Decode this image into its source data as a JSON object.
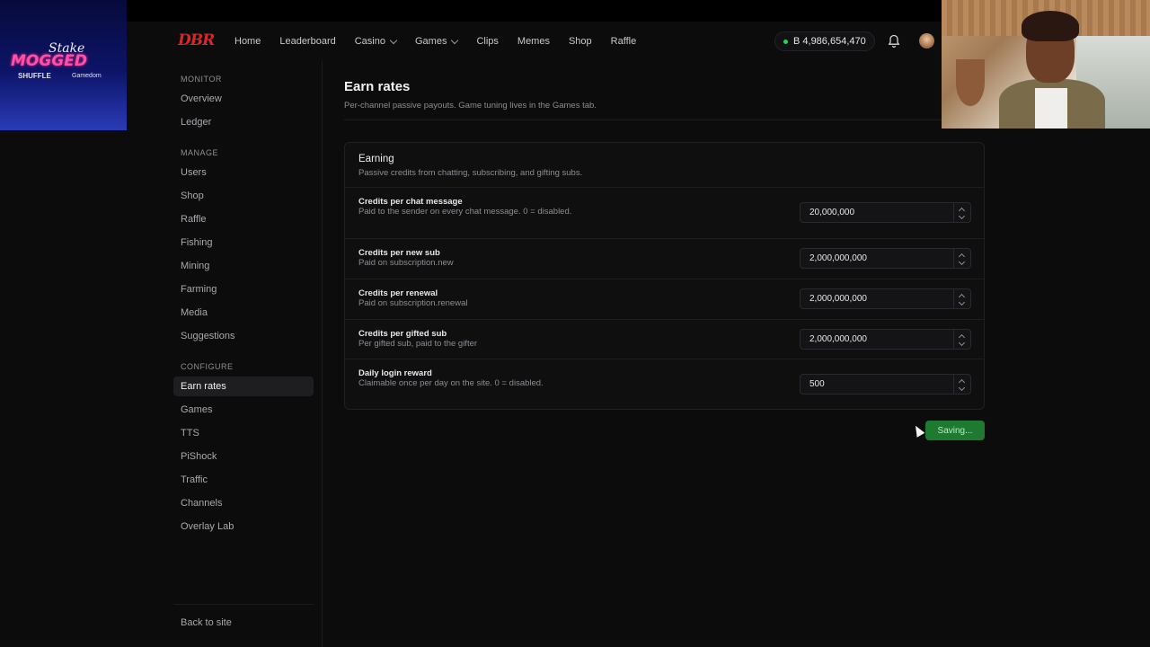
{
  "header": {
    "logo": "DBR",
    "nav": [
      {
        "label": "Home",
        "dropdown": false
      },
      {
        "label": "Leaderboard",
        "dropdown": false
      },
      {
        "label": "Casino",
        "dropdown": true
      },
      {
        "label": "Games",
        "dropdown": true
      },
      {
        "label": "Clips",
        "dropdown": false
      },
      {
        "label": "Memes",
        "dropdown": false
      },
      {
        "label": "Shop",
        "dropdown": false
      },
      {
        "label": "Raffle",
        "dropdown": false
      }
    ],
    "balance": "B 4,986,654,470",
    "balance_status_color": "#2fcf5f"
  },
  "overlay": {
    "sponsor_line1": "Stake",
    "sponsor_line2": "MOGGED",
    "sponsor_line3": "SHUFFLE",
    "sponsor_line4": "Gamedom"
  },
  "sidebar": {
    "sections": [
      {
        "title": "MONITOR",
        "items": [
          "Overview",
          "Ledger"
        ]
      },
      {
        "title": "MANAGE",
        "items": [
          "Users",
          "Shop",
          "Raffle",
          "Fishing",
          "Mining",
          "Farming",
          "Media",
          "Suggestions"
        ]
      },
      {
        "title": "CONFIGURE",
        "items": [
          "Earn rates",
          "Games",
          "TTS",
          "PiShock",
          "Traffic",
          "Channels",
          "Overlay Lab"
        ]
      }
    ],
    "active_item": "Earn rates",
    "footer": "Back to site"
  },
  "main": {
    "title": "Earn rates",
    "subtitle": "Per-channel passive payouts. Game tuning lives in the Games tab.",
    "card": {
      "title": "Earning",
      "subtitle": "Passive credits from chatting, subscribing, and gifting subs.",
      "rows": [
        {
          "label": "Credits per chat message",
          "desc": "Paid to the sender on every chat message. 0 = disabled.",
          "value": "20,000,000"
        },
        {
          "label": "Credits per new sub",
          "desc": "Paid on subscription.new",
          "value": "2,000,000,000"
        },
        {
          "label": "Credits per renewal",
          "desc": "Paid on subscription.renewal",
          "value": "2,000,000,000"
        },
        {
          "label": "Credits per gifted sub",
          "desc": "Per gifted sub, paid to the gifter",
          "value": "2,000,000,000"
        },
        {
          "label": "Daily login reward",
          "desc": "Claimable once per day on the site. 0 = disabled.",
          "value": "500"
        }
      ]
    },
    "save_label": "Saving...",
    "save_color": "#1f7a31"
  }
}
